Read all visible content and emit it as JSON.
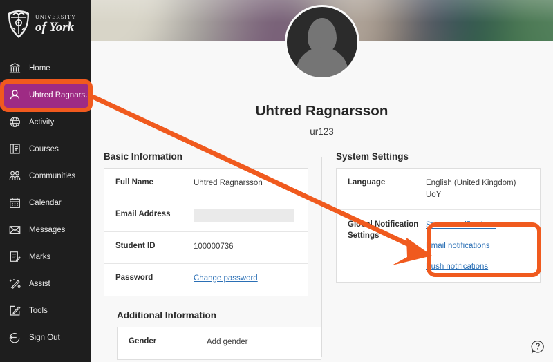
{
  "brand": {
    "line1": "UNIVERSITY",
    "line2": "of York",
    "crest_icon": "york-coat-of-arms-icon"
  },
  "sidebar": {
    "items": [
      {
        "label": "Home",
        "icon": "institution-icon",
        "active": false
      },
      {
        "label": "Uhtred Ragnars…",
        "icon": "person-icon",
        "active": true
      },
      {
        "label": "Activity",
        "icon": "globe-icon",
        "active": false
      },
      {
        "label": "Courses",
        "icon": "book-icon",
        "active": false
      },
      {
        "label": "Communities",
        "icon": "people-icon",
        "active": false
      },
      {
        "label": "Calendar",
        "icon": "calendar-icon",
        "active": false
      },
      {
        "label": "Messages",
        "icon": "envelope-icon",
        "active": false
      },
      {
        "label": "Marks",
        "icon": "graded-paper-icon",
        "active": false
      },
      {
        "label": "Assist",
        "icon": "magic-wand-icon",
        "active": false
      },
      {
        "label": "Tools",
        "icon": "edit-square-icon",
        "active": false
      },
      {
        "label": "Sign Out",
        "icon": "sign-out-icon",
        "active": false
      }
    ],
    "active_color": "#9e2b84",
    "background_color": "#1e1e1e"
  },
  "profile": {
    "name": "Uhtred Ragnarsson",
    "username": "ur123",
    "avatar_icon": "default-avatar-icon"
  },
  "basic_information": {
    "title": "Basic Information",
    "rows": [
      {
        "key": "Full Name",
        "value": "Uhtred Ragnarsson",
        "type": "text"
      },
      {
        "key": "Email Address",
        "value": "",
        "type": "redacted"
      },
      {
        "key": "Student ID",
        "value": "100000736",
        "type": "text"
      },
      {
        "key": "Password",
        "value": "Change password",
        "type": "link"
      }
    ]
  },
  "additional_information": {
    "title": "Additional Information",
    "rows": [
      {
        "key": "Gender",
        "value": "Add gender",
        "type": "text"
      }
    ]
  },
  "system_settings": {
    "title": "System Settings",
    "language": {
      "key": "Language",
      "value": "English (United Kingdom) UoY"
    },
    "global_notification": {
      "key": "Global Notification Settings",
      "links": [
        "Stream notifications",
        "Email notifications",
        "Push notifications"
      ]
    }
  },
  "help": {
    "icon": "help-question-bubble-icon",
    "label": "?"
  },
  "annotations": {
    "color": "#f05a1e",
    "highlight_sidebar_item": "Uhtred Ragnars…",
    "highlight_target": "Global Notification Settings links",
    "arrow": "from sidebar profile item to notification links"
  }
}
